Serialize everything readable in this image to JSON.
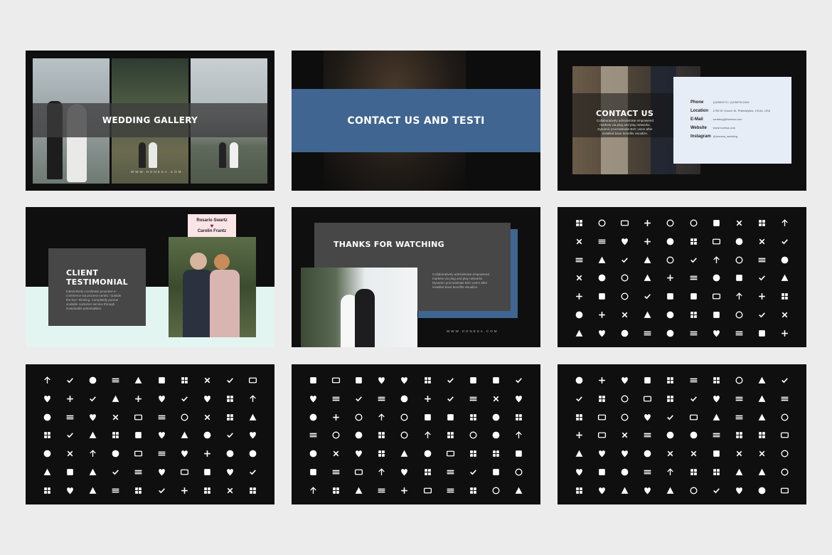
{
  "slides": {
    "gallery": {
      "title": "WEDDING GALLERY",
      "footer": "WWW.HONESA.COM"
    },
    "contact_banner": {
      "title": "CONTACT US AND TESTI"
    },
    "contact": {
      "title": "CONTACT US",
      "desc": "Collaboratively administrate empowered markets via plug and play networks. Dynamic procrastinate B2C users after installed base benefits visualize.",
      "rows": [
        {
          "label": "Phone",
          "value": "(1)0563274 / (1)0567612444"
        },
        {
          "label": "Location",
          "value": "2755 W Church St, Philadelphia, 19146, USA"
        },
        {
          "label": "E-Mail",
          "value": "wedding@honesa.com"
        },
        {
          "label": "Website",
          "value": "www.honesa.com"
        },
        {
          "label": "Instagram",
          "value": "@honesa_wedding"
        }
      ]
    },
    "testimonial": {
      "name1": "Rosario Swartz",
      "name2": "Carolin Frantz",
      "title_line1": "CLIENT",
      "title_line2": "TESTIMONIAL",
      "desc": "Interactively coordinate proactive e-commerce via process-centric \"outside the box\" thinking. Completely pursue scalable customer service through sustainable potentialities."
    },
    "thanks": {
      "title": "THANKS FOR WATCHING",
      "desc": "Collaboratively administrate empowered markets via plug and play networks. Dynamic procrastinate B2C users after installed base benefits visualize.",
      "footer": "WWW.HONESA.COM"
    }
  },
  "icon_sets": {
    "set1": [
      "wheelchair",
      "bank",
      "contact-card",
      "android",
      "accessibility",
      "account-circle",
      "wallet",
      "alarm",
      "add-photo",
      "snowflake",
      "notification-add",
      "medical",
      "account-box",
      "location",
      "cart-add",
      "plus",
      "alarm-add",
      "hotel",
      "seat",
      "recline",
      "bed",
      "alarm-plus",
      "bus",
      "flight-off",
      "android-2",
      "accessible",
      "infinity",
      "radio-button",
      "alarm-on",
      "alarm-check",
      "alarm-off",
      "calendar-box",
      "apps",
      "flight",
      "android-3",
      "pregnant",
      "cycle",
      "radio-on",
      "alarm-ring",
      "alarm-add-2",
      "arrow-back",
      "assignment-ind",
      "aspect-ratio",
      "list-alt",
      "arrow-up",
      "arrow-forward",
      "arrow-drop-up",
      "arrow-drop-down",
      "remove-circle",
      "arrow-down",
      "assignment-late",
      "music",
      "attachment",
      "dollar",
      "paperclip",
      "local-hospital",
      "assignment",
      "assignment-turned-in",
      "download-box",
      "work-box",
      "autorenew",
      "block",
      "shield-check",
      "gavel",
      "battery-alert",
      "battery-charging",
      "battery-full",
      "battery-std",
      "backspace",
      "timer"
    ],
    "set2": [
      "bluetooth",
      "border-outer",
      "border-all",
      "border-inner",
      "border-clear",
      "border-right",
      "border-style",
      "bluetooth-b",
      "bluetooth-connected",
      "bluetooth-disabled",
      "border-dotted",
      "border-horizontal",
      "border-left",
      "border-top",
      "border-vertical",
      "grid-dotted",
      "grid-dotted-2",
      "grid-dotted-3",
      "grid-dotted-4",
      "edit-pen",
      "featured-video",
      "image-wave",
      "brightness-auto",
      "settings-gear",
      "brightness-5",
      "brightness-a",
      "brightness-6",
      "moon",
      "moon-2",
      "circle",
      "brush",
      "arrow-outward",
      "phone-hangup",
      "cake",
      "sync",
      "toolbox",
      "view-column",
      "build",
      "bug",
      "bubble-chart",
      "call-received",
      "camera-iris",
      "sd-card",
      "phone-android",
      "traffic",
      "camera-alt",
      "panorama",
      "call-split",
      "arrow-down-left",
      "done-all",
      "cancel",
      "chat-bubble",
      "triangle",
      "center-focus",
      "crop-free",
      "cast",
      "cast-connected",
      "casino",
      "work",
      "desktop",
      "chat",
      "book",
      "list-box",
      "stroller",
      "eye-outline",
      "check",
      "check-circle",
      "check-box",
      "check-box-blank",
      "subject"
    ],
    "set3": [
      "notes",
      "code",
      "cloud-upload",
      "cloud",
      "cloud-off",
      "cloud-download",
      "cloud-done",
      "cloud-queue",
      "closed-caption",
      "close",
      "collections",
      "copy",
      "contact-page",
      "contacts",
      "contact-mail",
      "confirmation",
      "compare-arrows",
      "comment",
      "message",
      "colorize",
      "content-cut",
      "check-box-outline",
      "crop-landscape",
      "crop-7-5",
      "crop-din",
      "create-folder",
      "copyright",
      "add-circle",
      "control-point",
      "clipboard",
      "crop-free",
      "data-usage",
      "dashboard",
      "3d-rotation",
      "crop",
      "crop-square",
      "crop-rotate",
      "phone-portrait",
      "image-crop",
      "crop-portrait",
      "date-range",
      "grid-calendar",
      "triangle-down",
      "desktop-mac",
      "desktop-windows",
      "description",
      "delete",
      "delete-sweep",
      "dialpad-list",
      "dehaze",
      "dialer",
      "directions-bus",
      "directions-car",
      "directions-railway",
      "directions-boat",
      "directions-bike",
      "dialpad",
      "dialer-sip",
      "dns",
      "device-hub",
      "directions-run",
      "domain",
      "phone-iphone",
      "do-not-disturb",
      "do-not-disturb-alt",
      "dns-box",
      "disc",
      "directions",
      "directions-walk",
      "train"
    ],
    "set4": [
      "done-all",
      "lock",
      "eject",
      "place",
      "mail-list",
      "drag-handle",
      "drafts",
      "data-usage",
      "donut",
      "check",
      "equalizer",
      "input",
      "table",
      "more",
      "event-available",
      "event",
      "local-gas",
      "euro",
      "error",
      "error-outline",
      "expand-less",
      "exposure",
      "exposure-zero",
      "exposure-plus-2",
      "exposure-plus-1",
      "exposure-minus-2",
      "exposure-minus-1",
      "explore",
      "explicit",
      "expand-more",
      "extension",
      "fiber-manual",
      "fiber-dvr",
      "featured-play",
      "featured-video",
      "favorite",
      "favorite-border",
      "fast-rewind",
      "fast-forward",
      "face",
      "filter-7",
      "filter-none",
      "filter-list",
      "filter-center",
      "filter-frames",
      "filter-b-and-w",
      "filter-hdr",
      "filter-2",
      "filter-9-plus",
      "filter-9",
      "fiber-new",
      "filter-6",
      "filter-5",
      "filter-4",
      "filter-3",
      "filter-1",
      "filter-drama",
      "file-upload",
      "contrast",
      "fiber-pin",
      "filter-tilt",
      "center-focus-weak",
      "flag",
      "fullscreen",
      "first-page",
      "fingerprint",
      "find-replace",
      "find-in-page",
      "photo-library",
      "dot"
    ]
  }
}
